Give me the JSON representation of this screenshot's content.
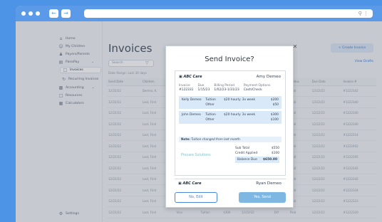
{
  "colors": {
    "background": "#4d93e6",
    "accent": "#4a86d8",
    "modal_highlight": "#d9e9f7",
    "yes_button": "#7fb7e3"
  },
  "browser": {
    "back_icon": "back-arrow-icon",
    "forward_icon": "forward-arrow-icon",
    "url": ""
  },
  "sidebar": {
    "items": [
      {
        "label": "Home",
        "icon": "home-icon"
      },
      {
        "label": "My Children",
        "icon": "children-icon"
      },
      {
        "label": "Payers/Parents",
        "icon": "users-icon"
      },
      {
        "label": "PanoPay",
        "icon": "card-icon"
      },
      {
        "label": "Invoices",
        "icon": "invoice-icon"
      },
      {
        "label": "Recurring Invoices",
        "icon": "repeat-icon"
      },
      {
        "label": "Accounting",
        "icon": "chart-icon"
      },
      {
        "label": "Resources",
        "icon": "folder-icon"
      },
      {
        "label": "Calculators",
        "icon": "calculator-icon"
      }
    ],
    "settings": "Settings"
  },
  "main": {
    "title": "Invoices",
    "create_label": "+  Create Invoice",
    "view_drafts": "View Drafts",
    "search_placeholder": "Search",
    "date_range": "Date Range: Last 30 days",
    "table": {
      "columns": [
        "Send Date",
        "Children",
        "Payer",
        "",
        "",
        "",
        "",
        "",
        "",
        "Status",
        "Due Date",
        "Invoice #"
      ],
      "rows": [
        [
          "12/22/22",
          "Demeo, K.",
          "Demeo",
          "",
          "",
          "",
          "",
          "",
          "",
          "Paid",
          "12/22/22",
          "#1222342"
        ],
        [
          "12/22/22",
          "Last, First",
          "Last",
          "",
          "",
          "",
          "",
          "",
          "",
          "Paid",
          "12/22/22",
          "#1222340"
        ],
        [
          "12/22/22",
          "Last, First",
          "Last",
          "",
          "",
          "",
          "",
          "",
          "",
          "Paid",
          "12/22/22",
          "#1222340"
        ],
        [
          "12/22/22",
          "Last, First",
          "Last",
          "",
          "",
          "",
          "",
          "",
          "",
          "Paid",
          "12/22/22",
          "#1222340"
        ],
        [
          "12/22/22",
          "Last, First",
          "Last",
          "",
          "",
          "",
          "",
          "",
          "",
          "Paid",
          "12/22/22",
          "#1222314"
        ],
        [
          "12/22/22",
          "Last, First",
          "Last",
          "",
          "",
          "",
          "",
          "",
          "",
          "Paid",
          "12/22/22",
          "#1222402"
        ],
        [
          "12/22/22",
          "Last, First",
          "Last",
          "",
          "",
          "",
          "",
          "",
          "",
          "Paid",
          "12/22/22",
          "#1222395"
        ],
        [
          "12/22/22",
          "Last, First",
          "Last",
          "",
          "",
          "",
          "",
          "",
          "",
          "Paid",
          "12/22/22",
          "#1222342"
        ],
        [
          "12/22/22",
          "Last, First",
          "Last",
          "",
          "",
          "",
          "",
          "",
          "",
          "Paid",
          "12/22/22",
          "#1222342"
        ],
        [
          "12/22/22",
          "Last, First",
          "Last",
          "",
          "",
          "",
          "",
          "",
          "",
          "Paid",
          "12/22/22",
          "#1222334"
        ],
        [
          "12/22/22",
          "Last, First",
          "Last",
          "",
          "",
          "",
          "",
          "",
          "",
          "Paid",
          "12/22/22",
          "#1222323"
        ],
        [
          "12/22/22",
          "Last, First",
          "Visa",
          "Tuition",
          "$300",
          "12/22/22",
          "",
          "DIY",
          "",
          "Paid",
          "12/22/22",
          "#1222320"
        ]
      ]
    }
  },
  "modal": {
    "title": "Send Invoice?",
    "close_icon": "close-icon",
    "invoice": {
      "business": "ABC Care",
      "customer": "Amy Demeo",
      "invoice_label": "Invoice",
      "invoice_num": "#122331",
      "due_label": "Due",
      "due": "1/15/23",
      "billing_label": "Billing Period",
      "billing": "1/02/23-1/31/23",
      "payment_label": "Payment Options",
      "payment": "Cash/Check",
      "lines": [
        {
          "name": "Kelly Demeo",
          "items": [
            {
              "type": "Tuition",
              "rate": "$20 hourly",
              "qty": "3x week",
              "amount": "$200"
            },
            {
              "type": "Other",
              "rate": "",
              "qty": "",
              "amount": "$50"
            }
          ]
        },
        {
          "name": "John Demeo",
          "items": [
            {
              "type": "Tuition",
              "rate": "$20 hourly",
              "qty": "3x week",
              "amount": "$300"
            },
            {
              "type": "Other",
              "rate": "",
              "qty": "",
              "amount": "$100"
            }
          ]
        }
      ],
      "note_label": "Note:",
      "note": "Tuition changed from last month.",
      "subtotal_label": "Sub Total",
      "subtotal": "$550",
      "credit_label": "Credit Applied",
      "credit": "$100",
      "balance_label": "Balance Due",
      "balance": "$650.00",
      "powered": "Procare Solutions"
    },
    "next_customer": "Ryan Demeo",
    "next_business": "ABC Care",
    "no_label": "No, Edit",
    "yes_label": "Yes, Send"
  }
}
